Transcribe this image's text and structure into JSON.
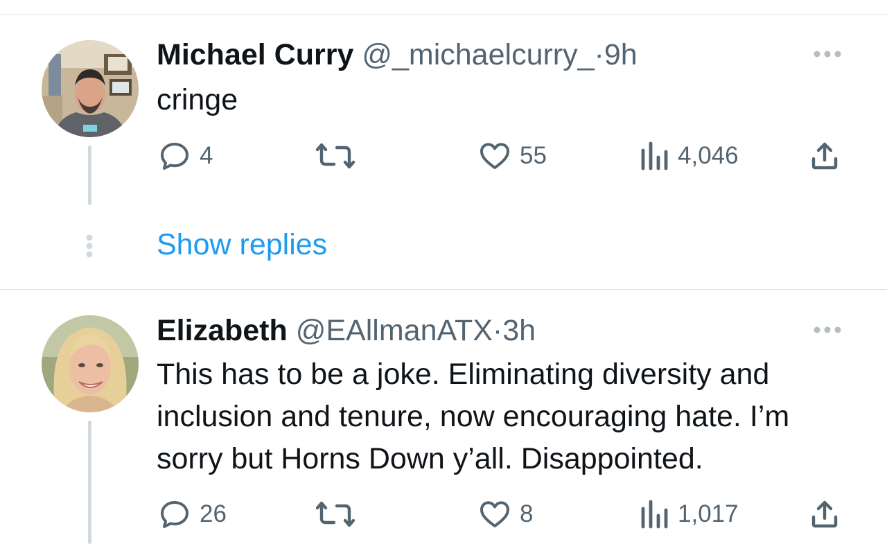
{
  "tweets": [
    {
      "name": "Michael Curry",
      "handle": "@_michaelcurry_",
      "separator": "·",
      "time": "9h",
      "text": "cringe",
      "replies": "4",
      "likes": "55",
      "views": "4,046"
    },
    {
      "name": "Elizabeth",
      "handle": "@EAllmanATX",
      "separator": "·",
      "time": "3h",
      "text": "This has to be a joke. Eliminating diversity and inclusion and tenure, now encouraging hate. I’m sorry but Horns Down y’all. Disappointed.",
      "replies": "26",
      "likes": "8",
      "views": "1,017"
    }
  ],
  "show_replies_label": "Show replies",
  "icons": {
    "more": "more-horizontal-icon",
    "reply": "reply-icon",
    "retweet": "retweet-icon",
    "like": "heart-icon",
    "views": "views-chart-icon",
    "share": "share-icon"
  },
  "colors": {
    "text": "#0f1419",
    "secondary": "#536471",
    "link": "#1d9bf0",
    "divider": "#d6dbdf",
    "thread_line": "#cfd9de"
  }
}
